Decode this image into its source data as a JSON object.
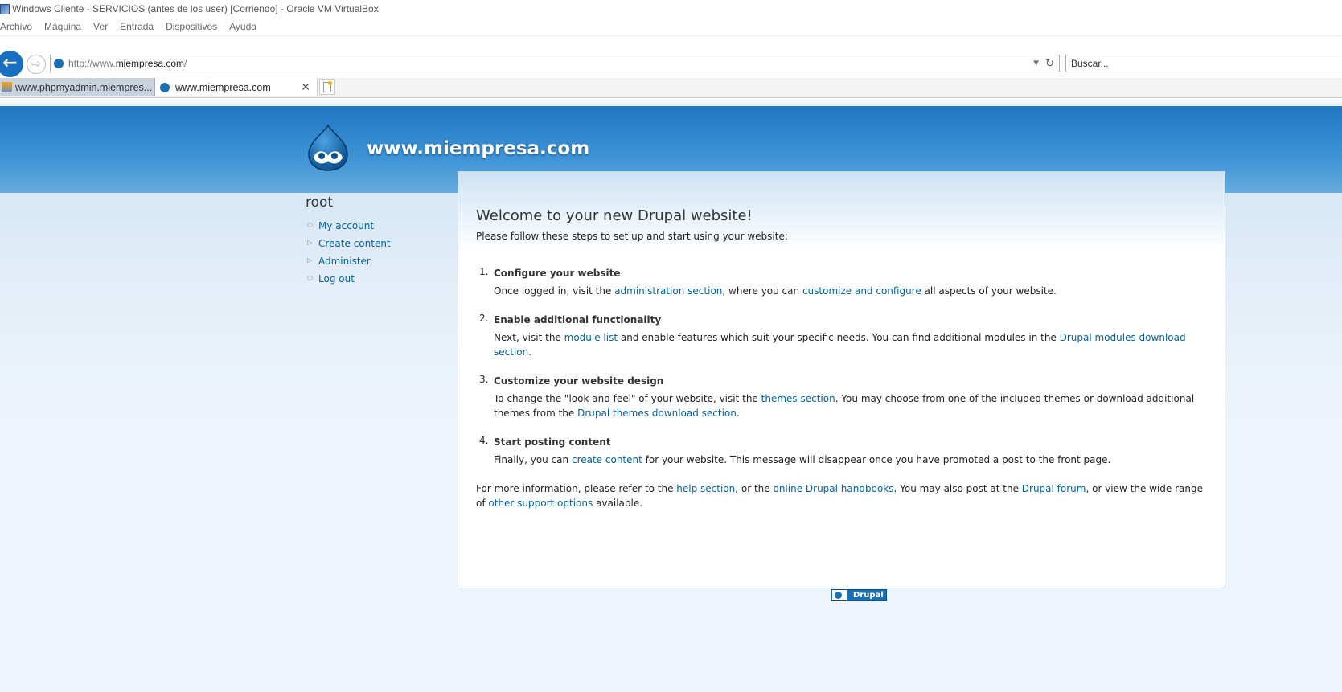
{
  "window": {
    "title": "Windows Cliente - SERVICIOS (antes de los user) [Corriendo] - Oracle VM VirtualBox",
    "menu": [
      "Archivo",
      "Máquina",
      "Ver",
      "Entrada",
      "Dispositivos",
      "Ayuda"
    ]
  },
  "browser": {
    "url_prefix": "http://www.",
    "url_domain": "miempresa.com",
    "url_suffix": "/",
    "search_placeholder": "Buscar...",
    "tabs": [
      {
        "label": "www.phpmyadmin.miempres..."
      },
      {
        "label": "www.miempresa.com"
      }
    ]
  },
  "site": {
    "name": "www.miempresa.com"
  },
  "sidebar": {
    "user": "root",
    "links": [
      "My account",
      "Create content",
      "Administer",
      "Log out"
    ]
  },
  "main": {
    "title": "Welcome to your new Drupal website!",
    "intro": "Please follow these steps to set up and start using your website:",
    "steps": [
      {
        "number": "1.",
        "title": "Configure your website",
        "t1": "Once logged in, visit the ",
        "l1": "administration section",
        "t2": ", where you can ",
        "l2": "customize and configure",
        "t3": " all aspects of your website."
      },
      {
        "number": "2.",
        "title": "Enable additional functionality",
        "t1": "Next, visit the ",
        "l1": "module list",
        "t2": " and enable features which suit your specific needs. You can find additional modules in the ",
        "l2": "Drupal modules download section",
        "t3": "."
      },
      {
        "number": "3.",
        "title": "Customize your website design",
        "t1": "To change the \"look and feel\" of your website, visit the ",
        "l1": "themes section",
        "t2": ". You may choose from one of the included themes or download additional themes from the ",
        "l2": "Drupal themes download section",
        "t3": "."
      },
      {
        "number": "4.",
        "title": "Start posting content",
        "t1": "Finally, you can ",
        "l1": "create content",
        "t2": " for your website. This message will disappear once you have promoted a post to the front page."
      }
    ],
    "more": {
      "t1": "For more information, please refer to the ",
      "l1": "help section",
      "t2": ", or the ",
      "l2": "online Drupal handbooks",
      "t3": ". You may also post at the ",
      "l3": "Drupal forum",
      "t4": ", or view the wide range of ",
      "l4": "other support options",
      "t5": " available."
    },
    "badge": "Drupal"
  },
  "colors": {
    "header": "#2a82c9",
    "link": "#0062a0",
    "page_bg": "#eef4fb"
  }
}
